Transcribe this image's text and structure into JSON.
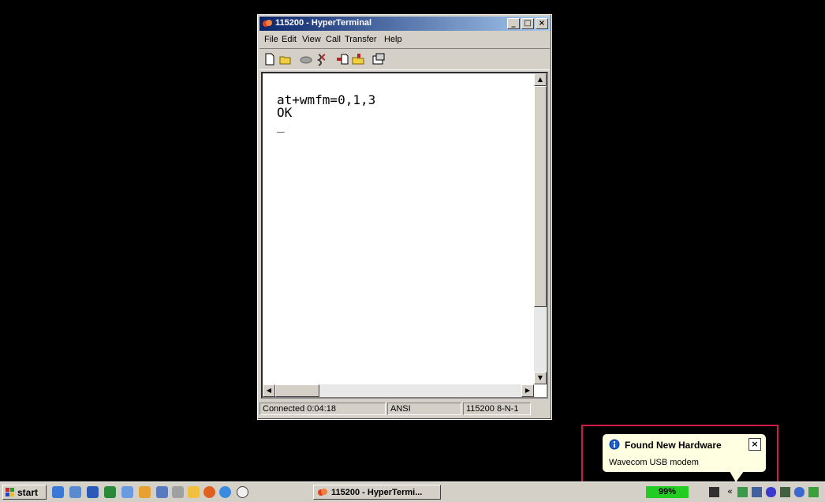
{
  "window": {
    "title": "115200 - HyperTerminal",
    "menu": [
      "File",
      "Edit",
      "View",
      "Call",
      "Transfer",
      "Help"
    ],
    "terminal_lines": "at+wmfm=0,1,3\nOK\n_",
    "status": {
      "connected": "Connected 0:04:18",
      "emulation": "ANSI",
      "port_settings": "115200 8-N-1"
    }
  },
  "taskbar": {
    "start_label": "start",
    "task_button_label": "115200 - HyperTermi...",
    "battery": "99%"
  },
  "balloon": {
    "title": "Found New Hardware",
    "message": "Wavecom USB modem"
  },
  "colors": {
    "titlebar": "#0a246a",
    "highlight_box": "#d11a4a",
    "battery": "#22cc22",
    "balloon_bg": "#ffffe1"
  }
}
